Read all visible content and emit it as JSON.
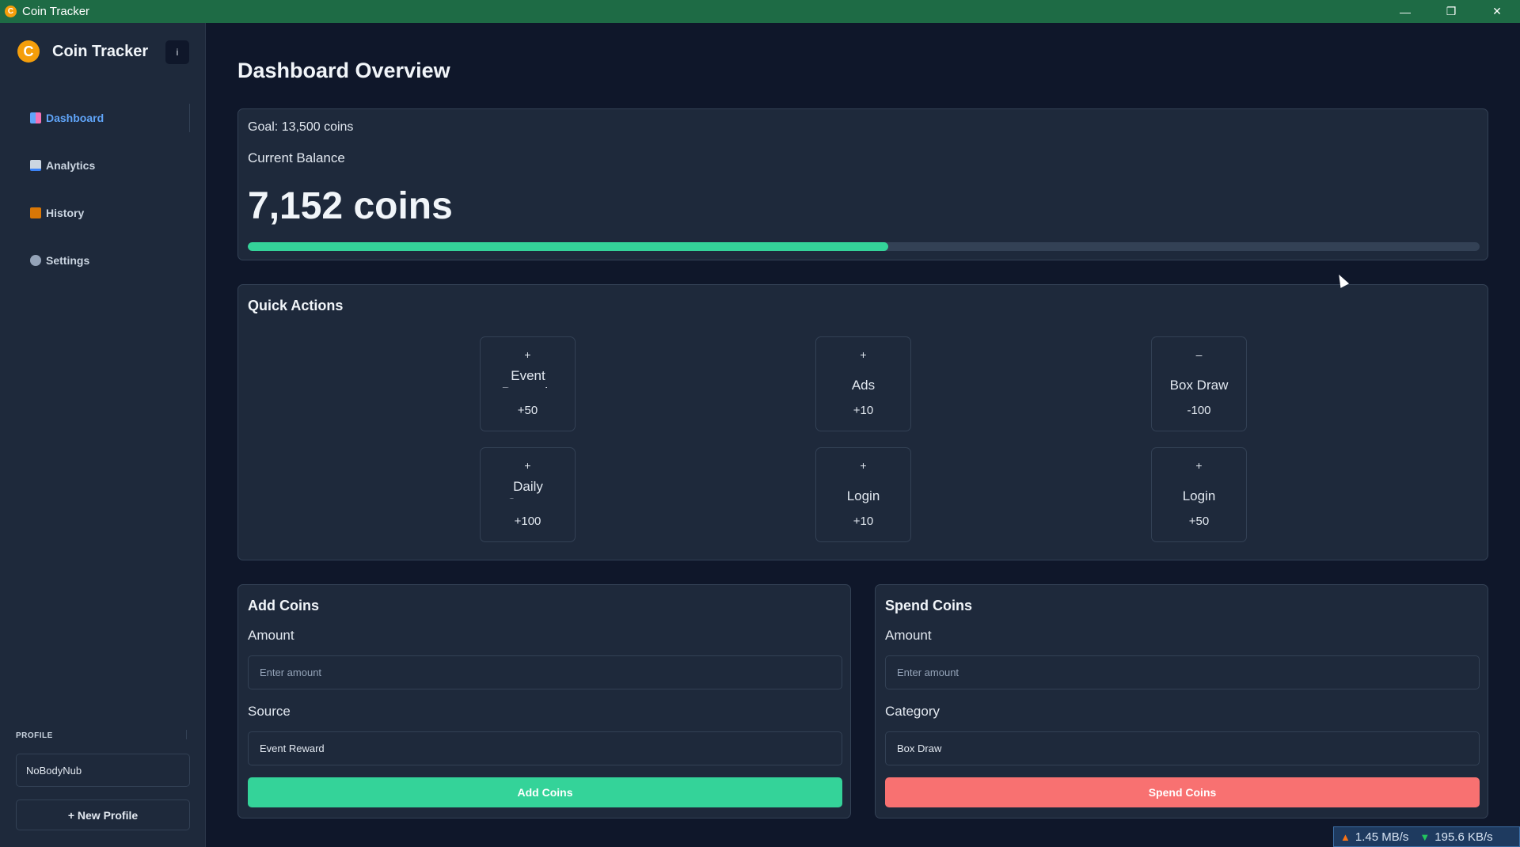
{
  "window": {
    "title": "Coin Tracker",
    "app_icon_glyph": "C",
    "controls": {
      "minimize": "—",
      "maximize": "❐",
      "close": "✕"
    }
  },
  "sidebar": {
    "brand_glyph": "C",
    "brand_name": "Coin Tracker",
    "info_label": "i",
    "nav": [
      {
        "label": "Dashboard",
        "icon": "dashboard-icon",
        "icon_color": "#60a5fa",
        "active": true
      },
      {
        "label": "Analytics",
        "icon": "analytics-icon",
        "icon_color": "#94a3b8",
        "active": false
      },
      {
        "label": "History",
        "icon": "history-icon",
        "icon_color": "#d97706",
        "active": false
      },
      {
        "label": "Settings",
        "icon": "settings-icon",
        "icon_color": "#94a3b8",
        "active": false
      }
    ],
    "profile_label": "PROFILE",
    "profile_name": "NoBodyNub",
    "new_profile_label": "+ New Profile"
  },
  "main": {
    "page_title": "Dashboard Overview",
    "balance": {
      "goal_text": "Goal: 13,500 coins",
      "current_label": "Current Balance",
      "value_text": "7,152 coins",
      "progress_fraction": 0.52,
      "progress_color": "#34d399"
    },
    "quick_actions": {
      "title": "Quick Actions",
      "items": [
        {
          "sign": "+",
          "name": "Event Rewards",
          "value": "+50"
        },
        {
          "sign": "+",
          "name": "Ads",
          "value": "+10"
        },
        {
          "sign": "–",
          "name": "Box Draw",
          "value": "-100"
        },
        {
          "sign": "+",
          "name": "Daily Games",
          "value": "+100"
        },
        {
          "sign": "+",
          "name": "Login",
          "value": "+10"
        },
        {
          "sign": "+",
          "name": "Login",
          "value": "+50"
        }
      ]
    },
    "add_coins": {
      "title": "Add Coins",
      "amount_label": "Amount",
      "amount_placeholder": "Enter amount",
      "source_label": "Source",
      "source_value": "Event Reward",
      "button_label": "Add Coins",
      "button_color": "#34d399"
    },
    "spend_coins": {
      "title": "Spend Coins",
      "amount_label": "Amount",
      "amount_placeholder": "Enter amount",
      "category_label": "Category",
      "category_value": "Box Draw",
      "button_label": "Spend Coins",
      "button_color": "#f87171"
    }
  },
  "network_monitor": {
    "upload": "1.45 MB/s",
    "download": "195.6 KB/s"
  }
}
